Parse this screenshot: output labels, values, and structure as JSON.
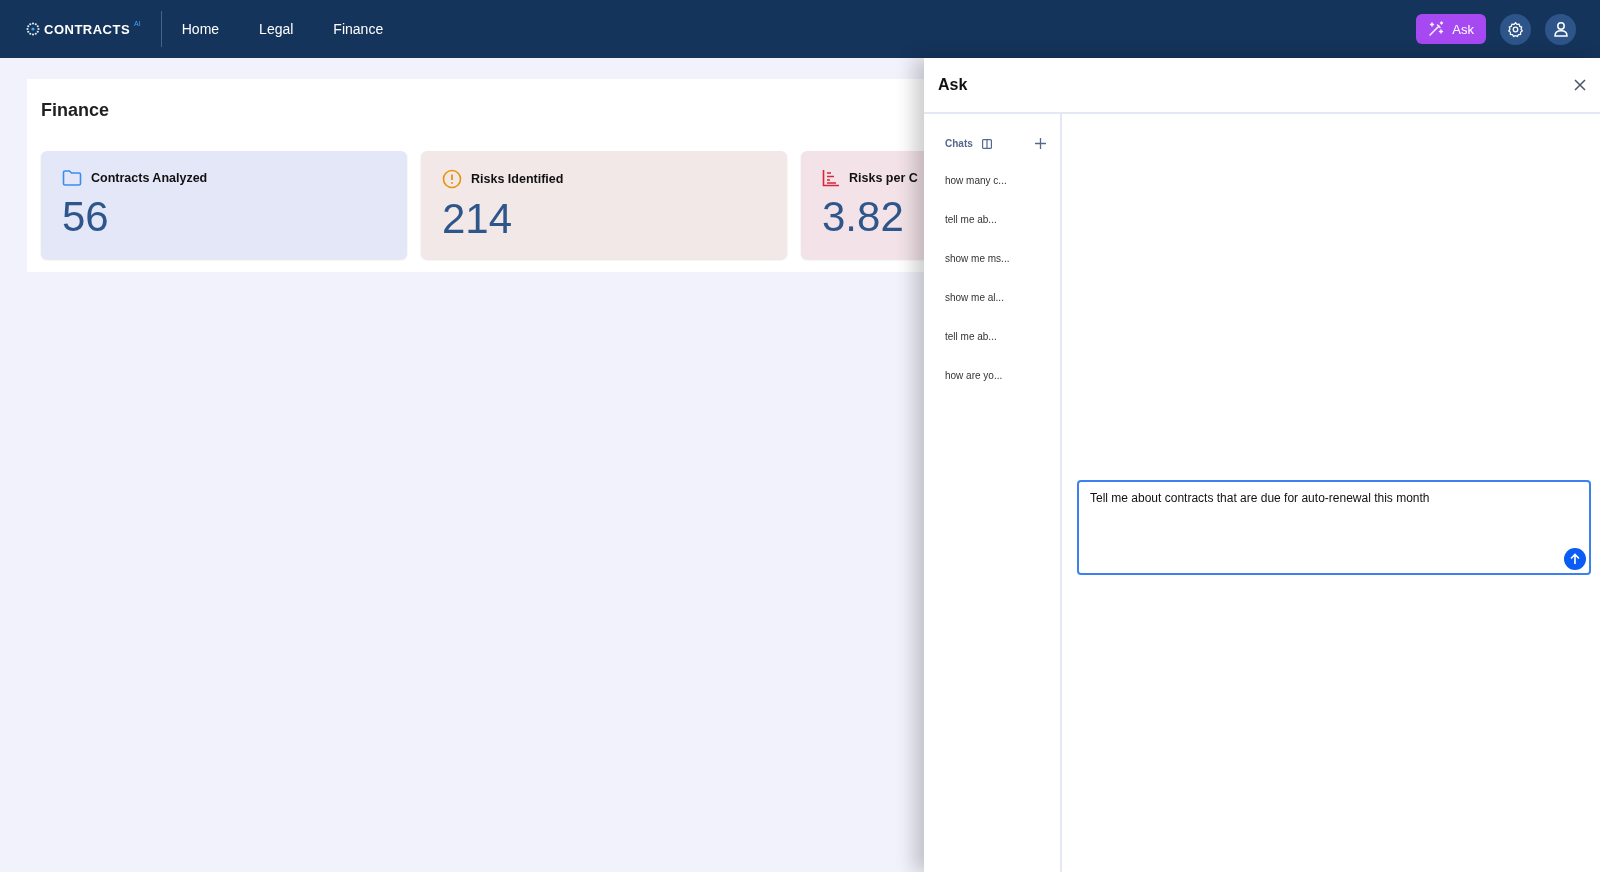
{
  "header": {
    "brand": "CONTRACTS",
    "brand_badge": "AI",
    "nav": [
      {
        "label": "Home"
      },
      {
        "label": "Legal"
      },
      {
        "label": "Finance"
      }
    ],
    "ask_button": "Ask"
  },
  "page": {
    "title": "Finance",
    "cards": [
      {
        "kind": "folder",
        "title": "Contracts Analyzed",
        "value": "56"
      },
      {
        "kind": "warning",
        "title": "Risks Identified",
        "value": "214"
      },
      {
        "kind": "chart",
        "title": "Risks per C",
        "value": "3.82"
      }
    ]
  },
  "ask_panel": {
    "title": "Ask",
    "chats_label": "Chats",
    "chats": [
      {
        "label": "how many c..."
      },
      {
        "label": "tell me ab..."
      },
      {
        "label": "show me ms..."
      },
      {
        "label": "show me al..."
      },
      {
        "label": "tell me ab..."
      },
      {
        "label": "how are yo..."
      }
    ],
    "message": "Tell me about contracts that are due for auto-renewal this month"
  }
}
